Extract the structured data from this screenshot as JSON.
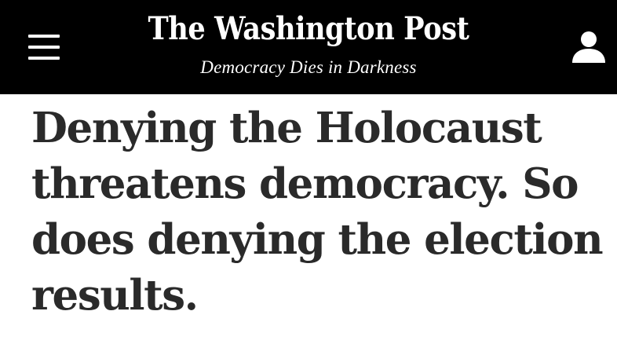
{
  "header": {
    "logo_text": "The Washington Post",
    "tagline": "Democracy Dies in Darkness",
    "menu_icon": "hamburger-menu-icon",
    "account_icon": "user-account-icon",
    "background_color": "#000000",
    "text_color": "#ffffff"
  },
  "article": {
    "headline": "Denying the Holocaust threatens democracy. So does denying the election results.",
    "headline_color": "#2a2a2a"
  }
}
